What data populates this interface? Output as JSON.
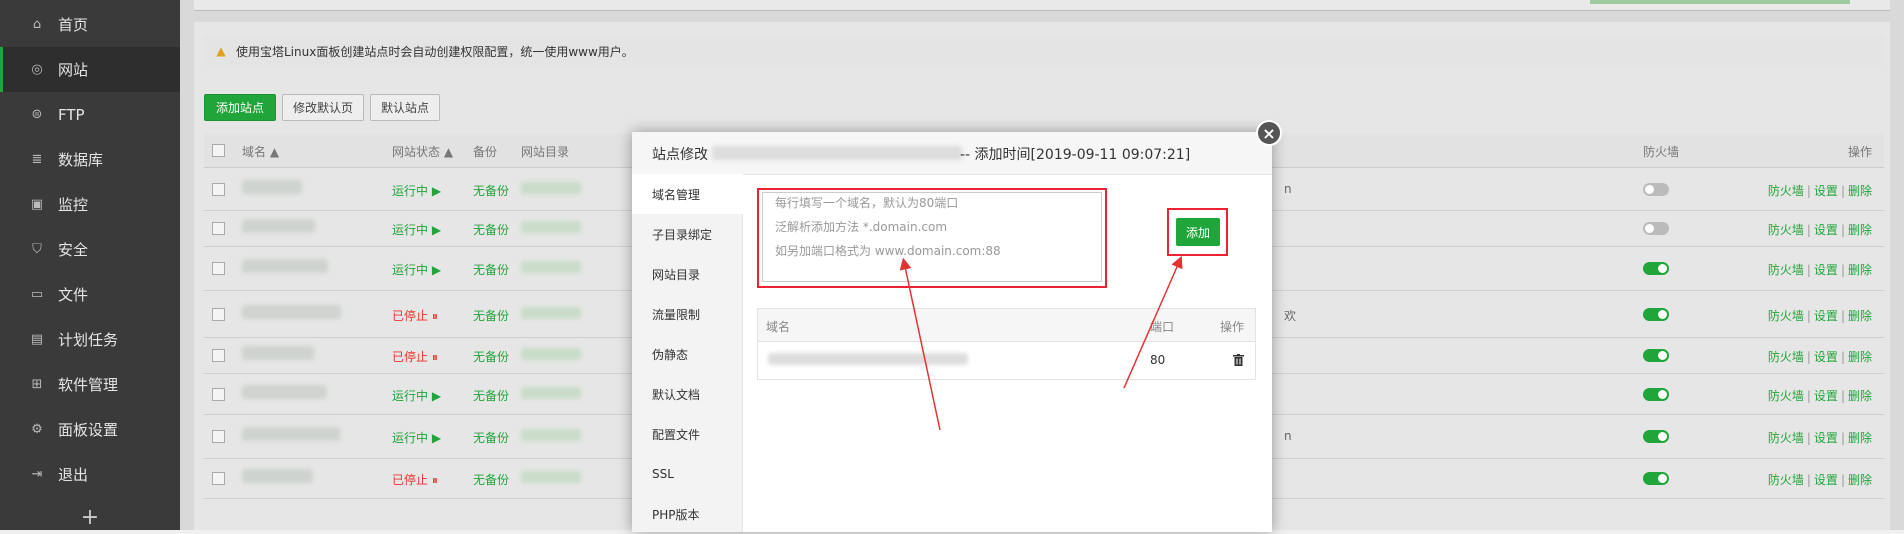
{
  "sidebar": {
    "items": [
      {
        "label": "首页",
        "icon": "home-icon",
        "glyph": "⌂"
      },
      {
        "label": "网站",
        "icon": "globe-icon",
        "glyph": "◎"
      },
      {
        "label": "FTP",
        "icon": "ftp-icon",
        "glyph": "⊜"
      },
      {
        "label": "数据库",
        "icon": "database-icon",
        "glyph": "≣"
      },
      {
        "label": "监控",
        "icon": "monitor-icon",
        "glyph": "▣"
      },
      {
        "label": "安全",
        "icon": "shield-icon",
        "glyph": "⛉"
      },
      {
        "label": "文件",
        "icon": "folder-icon",
        "glyph": "▭"
      },
      {
        "label": "计划任务",
        "icon": "calendar-icon",
        "glyph": "▤"
      },
      {
        "label": "软件管理",
        "icon": "grid-icon",
        "glyph": "⊞"
      },
      {
        "label": "面板设置",
        "icon": "gear-icon",
        "glyph": "⚙"
      },
      {
        "label": "退出",
        "icon": "logout-icon",
        "glyph": "⇥"
      }
    ],
    "active_index": 1,
    "add_label": "+"
  },
  "notice": {
    "icon": "warning-icon",
    "glyph": "▲",
    "text": "使用宝塔Linux面板创建站点时会自动创建权限配置，统一使用www用户。"
  },
  "toolbar": {
    "add_site": "添加站点",
    "edit_default_page": "修改默认页",
    "default_site": "默认站点"
  },
  "table": {
    "columns": {
      "name": "域名 ▲",
      "status": "网站状态 ▲",
      "backup": "备份",
      "dir": "网站目录",
      "firewall": "防火墙",
      "ops": "操作"
    },
    "rows": [
      {
        "status": "运行中 ▶",
        "state": "run",
        "backup": "无备份",
        "partial": "n",
        "firewall": false
      },
      {
        "status": "运行中 ▶",
        "state": "run",
        "backup": "无备份",
        "partial": "",
        "firewall": false
      },
      {
        "status": "运行中 ▶",
        "state": "run",
        "backup": "无备份",
        "partial": "",
        "firewall": true
      },
      {
        "status": "已停止 ⏸",
        "state": "stop",
        "backup": "无备份",
        "partial": "欢",
        "firewall": true
      },
      {
        "status": "已停止 ⏸",
        "state": "stop",
        "backup": "无备份",
        "partial": "",
        "firewall": true
      },
      {
        "status": "运行中 ▶",
        "state": "run",
        "backup": "无备份",
        "partial": "",
        "firewall": true
      },
      {
        "status": "运行中 ▶",
        "state": "run",
        "backup": "无备份",
        "partial": "n",
        "firewall": true
      },
      {
        "status": "已停止 ⏸",
        "state": "stop",
        "backup": "无备份",
        "partial": "",
        "firewall": true
      }
    ],
    "op_labels": {
      "firewall": "防火墙",
      "settings": "设置",
      "delete": "删除",
      "sep": "|"
    }
  },
  "dialog": {
    "title_prefix": "站点修改",
    "title_suffix": "-- 添加时间[2019-09-11 09:07:21]",
    "close_label": "×",
    "menu": [
      "域名管理",
      "子目录绑定",
      "网站目录",
      "流量限制",
      "伪静态",
      "默认文档",
      "配置文件",
      "SSL",
      "PHP版本"
    ],
    "active_menu": 0,
    "textarea_placeholder_lines": [
      "每行填写一个域名，默认为80端口",
      "泛解析添加方法 *.domain.com",
      "如另加端口格式为 www.domain.com:88"
    ],
    "add_button": "添加",
    "domain_table": {
      "headers": {
        "domain": "域名",
        "port": "端口",
        "ops": "操作"
      },
      "rows": [
        {
          "port": "80"
        }
      ]
    }
  },
  "colors": {
    "accent": "#20a53a",
    "annotation_red": "#e23333",
    "stopped": "#e33333"
  }
}
